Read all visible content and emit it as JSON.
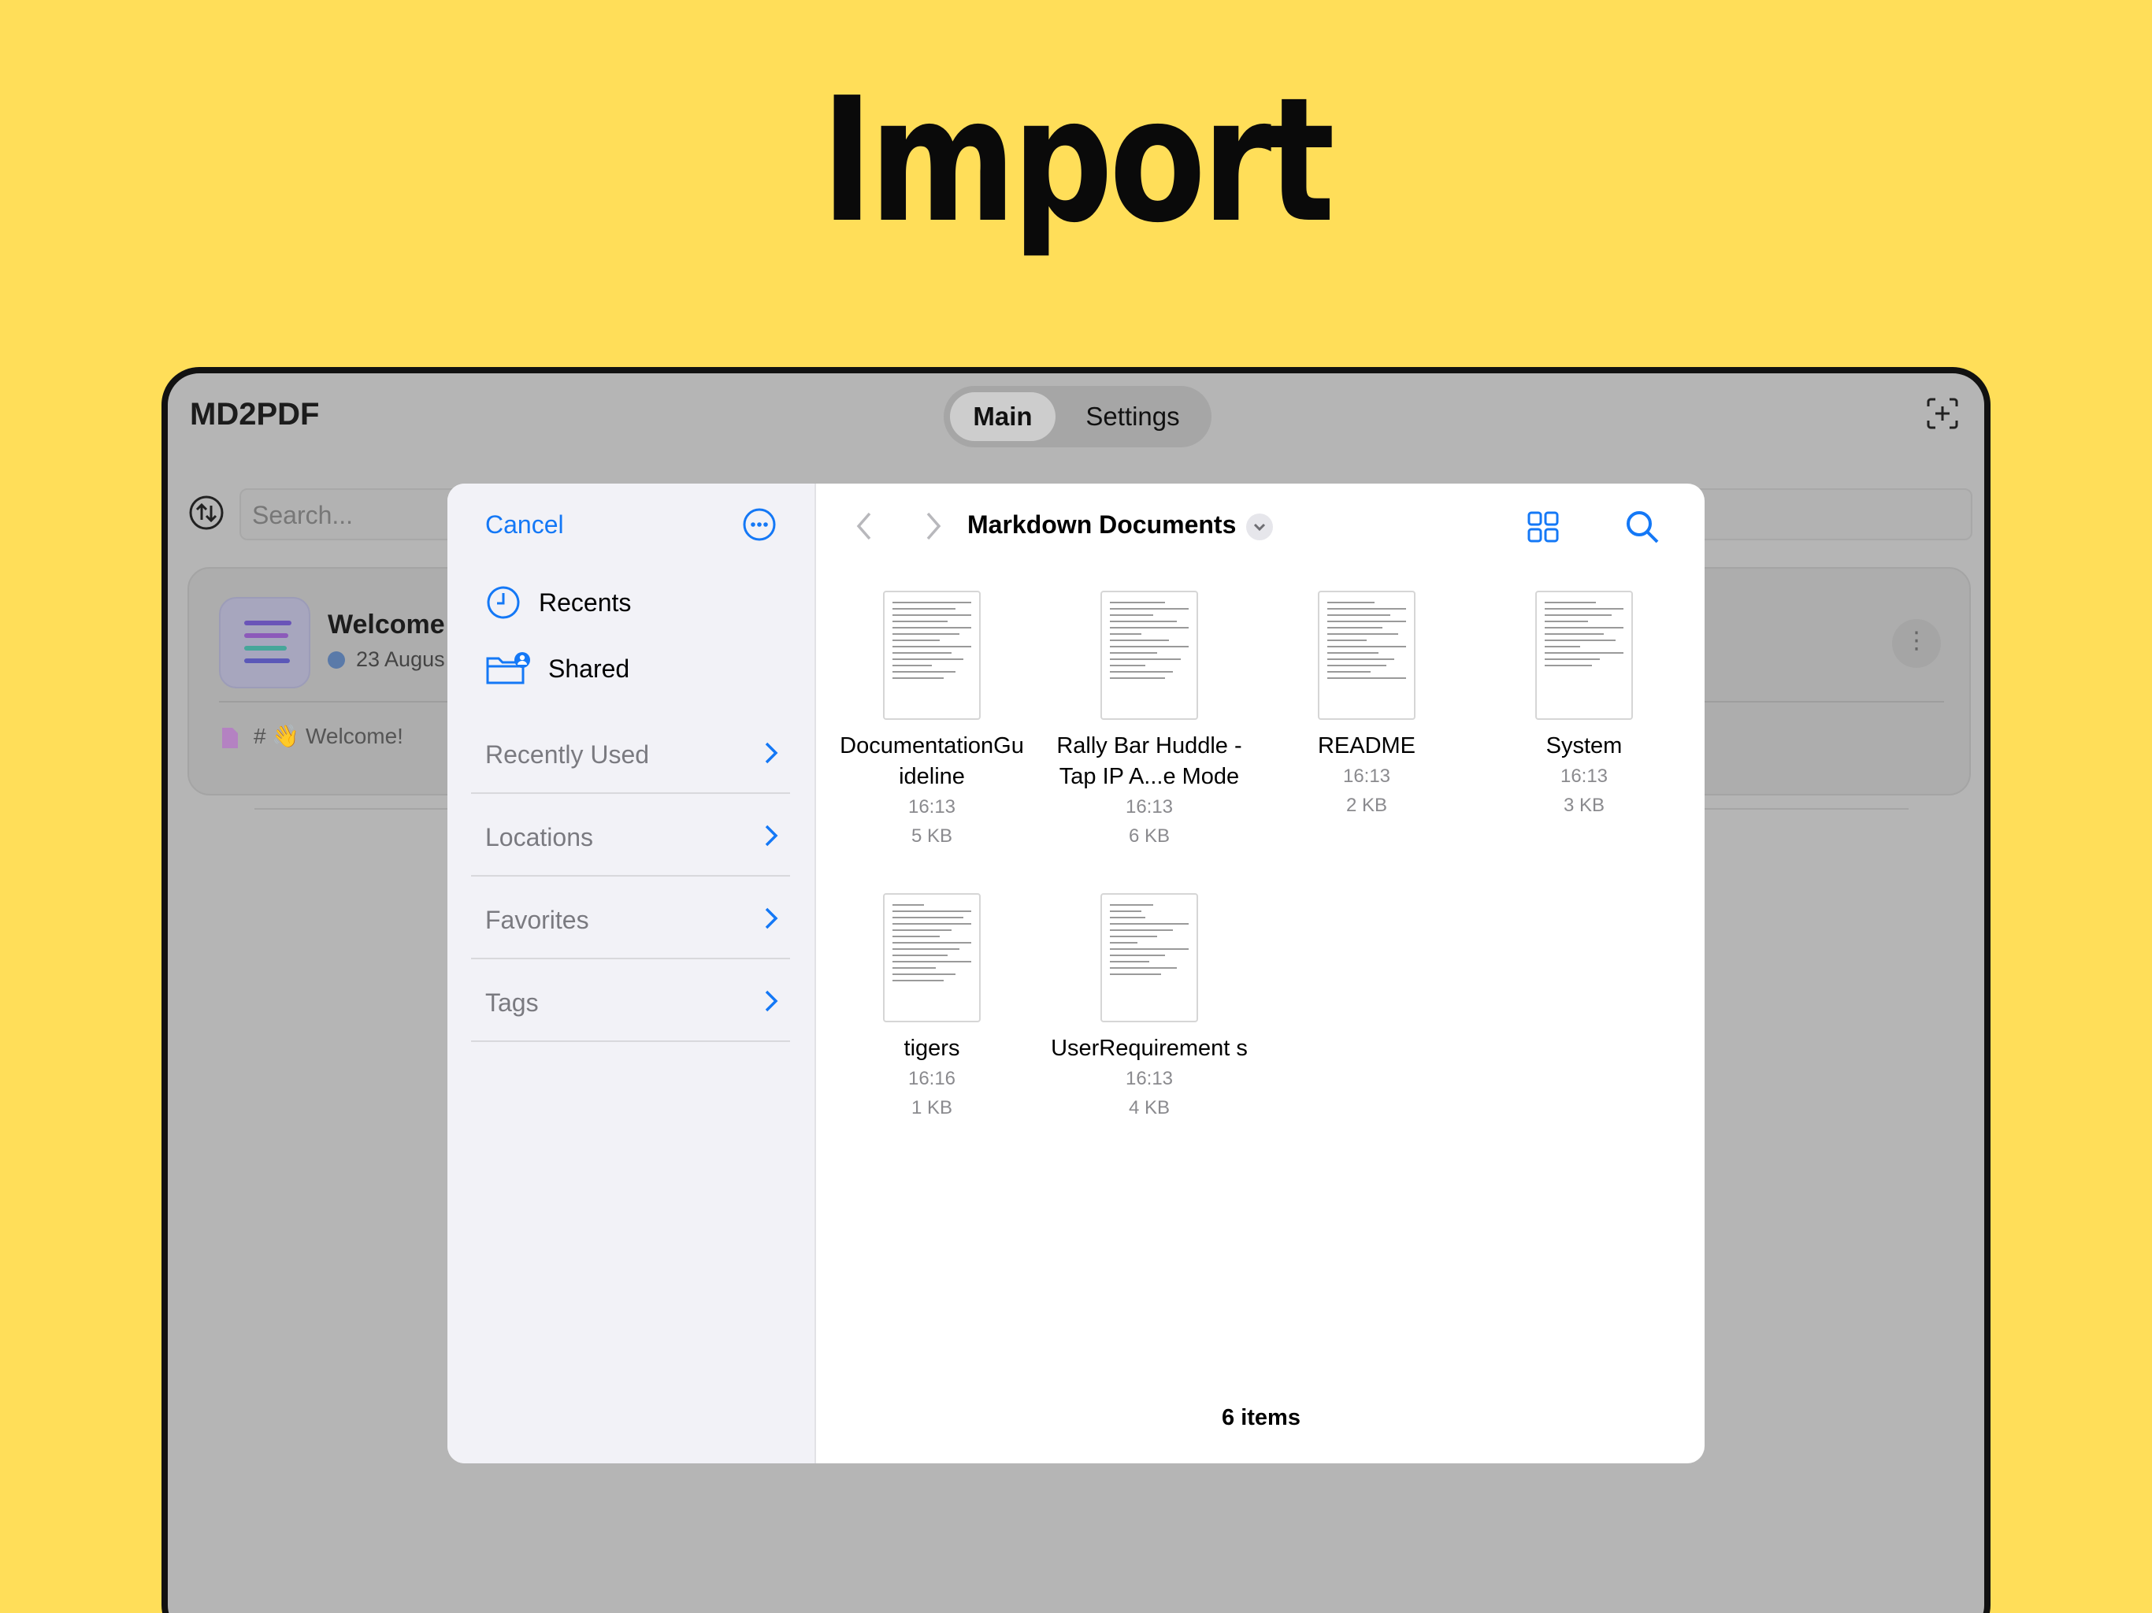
{
  "headline": "Import",
  "app": {
    "title": "MD2PDF",
    "tabs": {
      "main": "Main",
      "settings": "Settings"
    },
    "search_placeholder": "Search...",
    "card": {
      "title": "Welcome",
      "date": "23 Augus",
      "preview": "# 👋 Welcome!"
    }
  },
  "picker": {
    "cancel_label": "Cancel",
    "quick": [
      {
        "label": "Recents",
        "icon": "clock-icon"
      },
      {
        "label": "Shared",
        "icon": "shared-folder-icon"
      }
    ],
    "groups": [
      "Recently Used",
      "Locations",
      "Favorites",
      "Tags"
    ],
    "folder_title": "Markdown Documents",
    "files": [
      {
        "name": "DocumentationGu ideline",
        "time": "16:13",
        "size": "5 KB"
      },
      {
        "name": "Rally Bar Huddle - Tap IP A...e Mode",
        "time": "16:13",
        "size": "6 KB"
      },
      {
        "name": "README",
        "time": "16:13",
        "size": "2 KB"
      },
      {
        "name": "System",
        "time": "16:13",
        "size": "3 KB"
      },
      {
        "name": "tigers",
        "time": "16:16",
        "size": "1 KB"
      },
      {
        "name": "UserRequirement s",
        "time": "16:13",
        "size": "4 KB"
      }
    ],
    "items_count": "6 items"
  },
  "colors": {
    "background": "#FFDE59",
    "accent": "#1478F6"
  }
}
